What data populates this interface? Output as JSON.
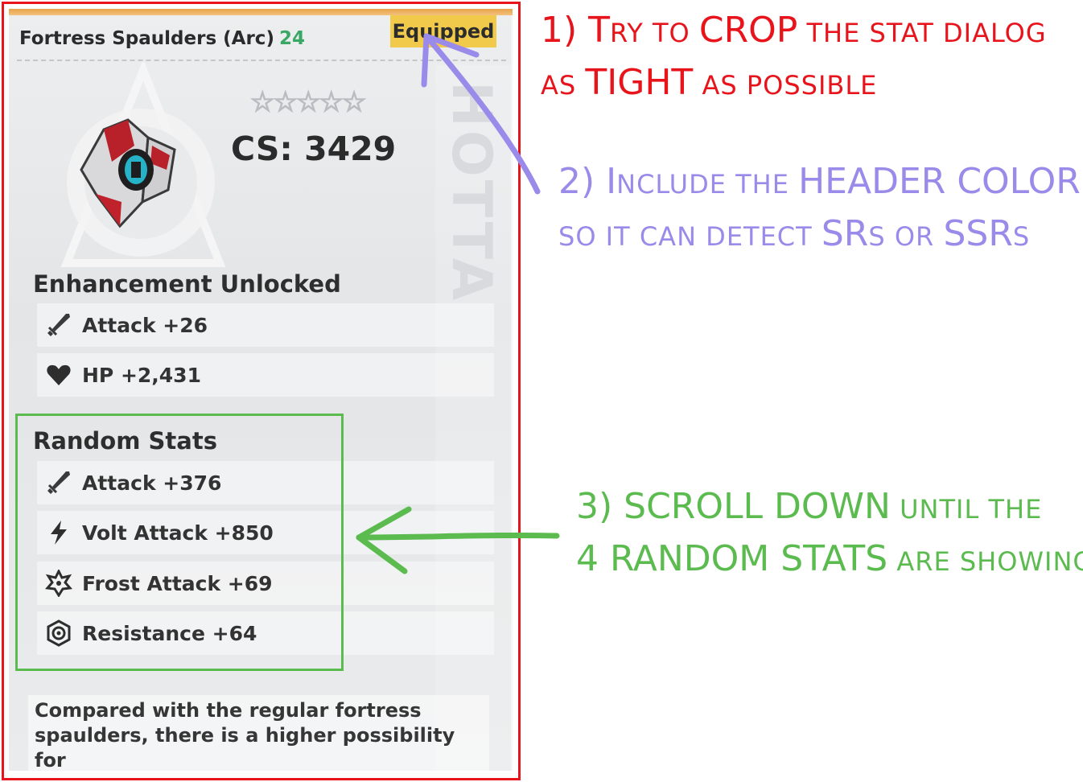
{
  "dialog": {
    "item_name": "Fortress Spaulders (Arc)",
    "item_level": "24",
    "equipped": "Equipped",
    "stars": "☆☆☆☆☆",
    "cs_label": "CS:",
    "cs_value": "3429",
    "header_color": "#f0b060",
    "enhancement": {
      "title": "Enhancement Unlocked",
      "stats": [
        {
          "icon": "attack-icon",
          "label": "Attack +26"
        },
        {
          "icon": "hp-heart-icon",
          "label": "HP +2,431"
        }
      ]
    },
    "random": {
      "title": "Random Stats",
      "stats": [
        {
          "icon": "attack-icon",
          "label": "Attack +376"
        },
        {
          "icon": "volt-icon",
          "label": "Volt Attack +850"
        },
        {
          "icon": "frost-icon",
          "label": "Frost Attack +69"
        },
        {
          "icon": "resistance-icon",
          "label": "Resistance +64"
        }
      ]
    },
    "description": "Compared with the regular fortress spaulders, there is a higher possibility for"
  },
  "annotations": {
    "note1": {
      "line1": [
        {
          "t": "1) T",
          "s": "big"
        },
        {
          "t": "RY TO ",
          "s": "sm"
        },
        {
          "t": "CROP",
          "s": "big"
        },
        {
          "t": " THE STAT DIALOG",
          "s": "sm"
        }
      ],
      "line2": [
        {
          "t": "AS ",
          "s": "sm"
        },
        {
          "t": "TIGHT",
          "s": "big"
        },
        {
          "t": " AS POSSIBLE",
          "s": "sm"
        }
      ],
      "color": "#e8141c"
    },
    "note2": {
      "line1": [
        {
          "t": "2) I",
          "s": "big"
        },
        {
          "t": "NCLUDE THE ",
          "s": "sm"
        },
        {
          "t": "HEADER COLOR",
          "s": "big"
        }
      ],
      "line2": [
        {
          "t": "SO IT CAN DETECT ",
          "s": "sm"
        },
        {
          "t": "SR",
          "s": "big"
        },
        {
          "t": "S OR ",
          "s": "sm"
        },
        {
          "t": "SSR",
          "s": "big"
        },
        {
          "t": "S",
          "s": "sm"
        }
      ],
      "color": "#9a8ae9"
    },
    "note3": {
      "line1": [
        {
          "t": "3) SCROLL DOWN",
          "s": "big"
        },
        {
          "t": " UNTIL THE",
          "s": "sm"
        }
      ],
      "line2": [
        {
          "t": "4 RANDOM STATS",
          "s": "big"
        },
        {
          "t": " ARE SHOWING",
          "s": "sm"
        }
      ],
      "color": "#5bbb4f"
    }
  }
}
